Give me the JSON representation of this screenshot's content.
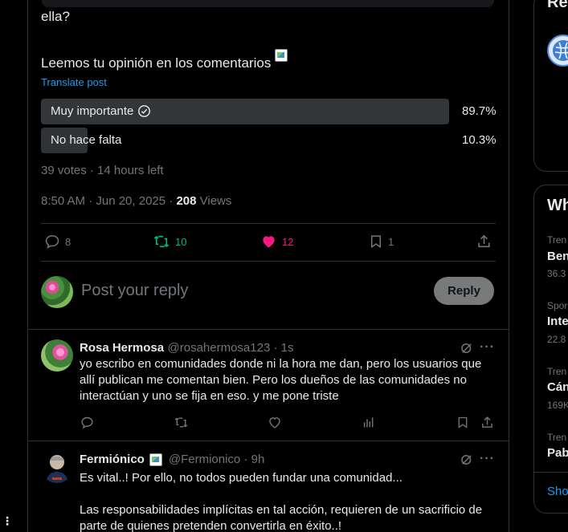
{
  "post": {
    "text_line1": "ella?",
    "text_line2": "Leemos tu opinión en los comentarios",
    "translate": "Translate post",
    "poll": {
      "options": [
        {
          "label": "Muy importante",
          "percent": "89.7%",
          "fraction": 0.897,
          "winner": true
        },
        {
          "label": "No hace falta",
          "percent": "10.3%",
          "fraction": 0.103,
          "winner": false
        }
      ],
      "meta": "39 votes · 14 hours left"
    },
    "timestamp": "8:50 AM · Jun 20, 2025 · ",
    "views_count": "208",
    "views_label": " Views",
    "actions": {
      "replies": "8",
      "reposts": "10",
      "likes": "12",
      "bookmarks": "1"
    }
  },
  "composer": {
    "placeholder": "Post your reply",
    "button": "Reply"
  },
  "replies": [
    {
      "name": "Rosa Hermosa",
      "handle": "@rosahermosa123 · 1s",
      "lines": [
        "yo escribo en comunidades donde ni la hora me dan, pero los usuarios que",
        "allí publican me comentan bien. Pero los dueños de las comunidades no",
        "interactúan y uno se fija en eso. y me pone triste"
      ]
    },
    {
      "name": "Fermiónico",
      "handle": "@Fermionico · 9h",
      "lines": [
        "Es vital..! Por ello, no todos pueden fundar una comunidad...",
        "",
        "Las responsabilidades implícitas en tal acción, requieren de un sacrificio de",
        "parte de quienes pretenden convertirla en éxito..!"
      ]
    }
  ],
  "sidebar": {
    "card1_title": "Re",
    "card2_title": "Wh",
    "trends": [
      {
        "category": "Tren",
        "title": "Ben",
        "count": "36.3"
      },
      {
        "category": "Spor",
        "title": "Inte",
        "count": "22.8"
      },
      {
        "category": "Tren",
        "title": "Cán",
        "count": "169K"
      },
      {
        "category": "Tren",
        "title": "Pab",
        "count": ""
      }
    ],
    "show_more": "Sho"
  },
  "colors": {
    "accent": "#1d9bf0",
    "repost": "#00ba7c",
    "like": "#f91880",
    "poll_winner": "#333639",
    "poll_other": "#2f3336"
  }
}
